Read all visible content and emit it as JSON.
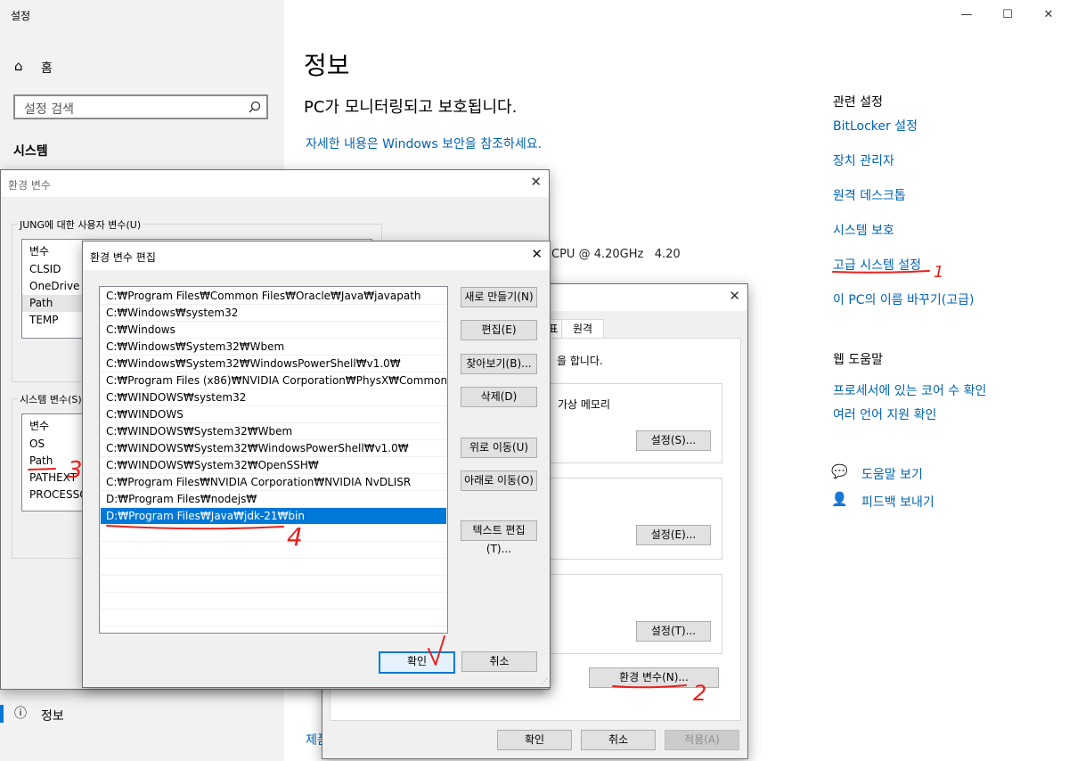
{
  "settings": {
    "window_title": "설정",
    "home_label": "홈",
    "search_placeholder": "설정 검색",
    "section_label": "시스템",
    "nav_active_label": "정보",
    "page_title": "정보",
    "pc_status": "PC가 모니터링되고 보호됩니다.",
    "security_link": "자세한 내용은 Windows 보안을 참조하세요.",
    "cpu_text": "CPU @ 4.20GHz   4.20",
    "bottom_text": "제품",
    "related_header": "관련 설정",
    "related_links": [
      "BitLocker 설정",
      "장치 관리자",
      "원격 데스크톱",
      "시스템 보호",
      "고급 시스템 설정",
      "이 PC의 이름 바꾸기(고급)"
    ],
    "web_help_header": "웹 도움말",
    "web_help_links": [
      "프로세서에 있는 코어 수 확인",
      "여러 언어 지원 확인"
    ],
    "help_label": "도움말 보기",
    "feedback_label": "피드백 보내기"
  },
  "sysprops": {
    "tabs": [
      "표",
      "원격"
    ],
    "desc_text": "을 합니다.",
    "virtual_memory_text": "가상 메모리",
    "settings_buttons": [
      "설정(S)...",
      "설정(E)...",
      "설정(T)..."
    ],
    "env_button": "환경 변수(N)...",
    "ok": "확인",
    "cancel": "취소",
    "apply": "적용(A)"
  },
  "env_vars": {
    "title": "환경 변수",
    "user_group_label": "JUNG에 대한 사용자 변수(U)",
    "user_header": "변수",
    "user_vars": [
      "CLSID",
      "OneDrive",
      "Path",
      "TEMP"
    ],
    "system_group_label": "시스템 변수(S)",
    "system_header": "변수",
    "system_vars": [
      "OS",
      "Path",
      "PATHEXT",
      "PROCESSOR"
    ]
  },
  "edit_env": {
    "title": "환경 변수 편집",
    "paths": [
      "C:₩Program Files₩Common Files₩Oracle₩Java₩javapath",
      "C:₩Windows₩system32",
      "C:₩Windows",
      "C:₩Windows₩System32₩Wbem",
      "C:₩Windows₩System32₩WindowsPowerShell₩v1.0₩",
      "C:₩Program Files (x86)₩NVIDIA Corporation₩PhysX₩Common",
      "C:₩WINDOWS₩system32",
      "C:₩WINDOWS",
      "C:₩WINDOWS₩System32₩Wbem",
      "C:₩WINDOWS₩System32₩WindowsPowerShell₩v1.0₩",
      "C:₩WINDOWS₩System32₩OpenSSH₩",
      "C:₩Program Files₩NVIDIA Corporation₩NVIDIA NvDLISR",
      "D:₩Program Files₩nodejs₩",
      "D:₩Program Files₩Java₩jdk-21₩bin"
    ],
    "selected_index": 13,
    "buttons": [
      "새로 만들기(N)",
      "편집(E)",
      "찾아보기(B)...",
      "삭제(D)",
      "위로 이동(U)",
      "아래로 이동(O)",
      "텍스트 편집(T)..."
    ],
    "ok": "확인",
    "cancel": "취소"
  },
  "annotations": [
    "1",
    "2",
    "3",
    "4"
  ],
  "colors": {
    "accent": "#0078d7",
    "link": "#0063b1",
    "annotation": "#e8201c"
  }
}
